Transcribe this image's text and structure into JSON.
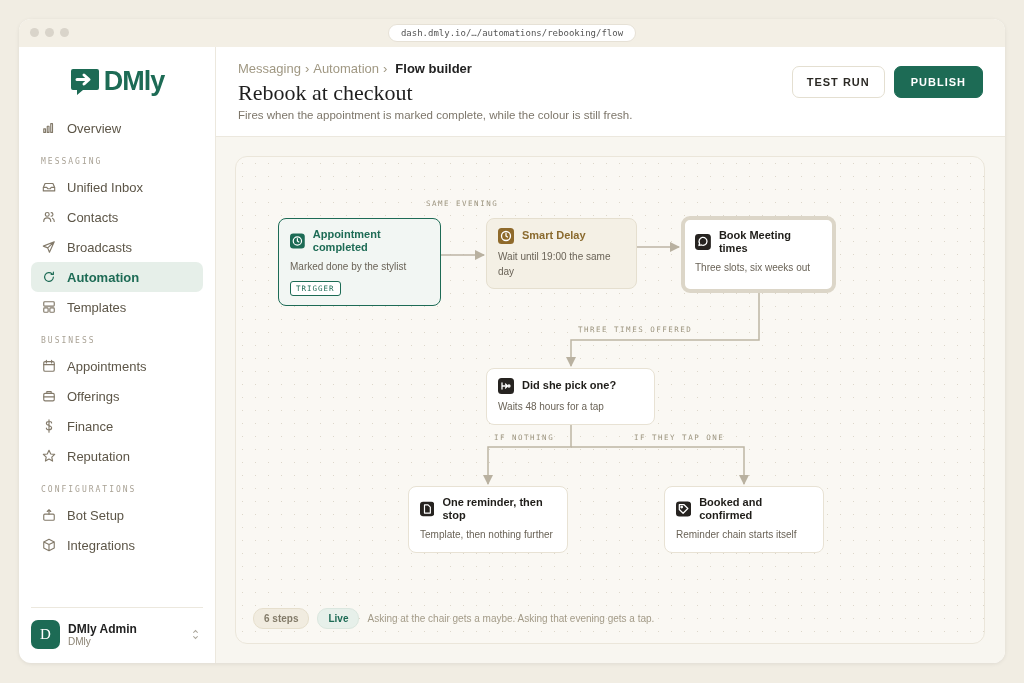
{
  "browser": {
    "url": "dash.dmly.io/…/automations/rebooking/flow"
  },
  "sidebar": {
    "logo": "DMly",
    "sections": [
      {
        "items": [
          {
            "label": "Overview",
            "selected": false
          }
        ]
      },
      {
        "heading": "MESSAGING",
        "items": [
          {
            "label": "Unified Inbox",
            "selected": false
          },
          {
            "label": "Contacts",
            "selected": false
          },
          {
            "label": "Broadcasts",
            "selected": false
          },
          {
            "label": "Automation",
            "selected": true
          },
          {
            "label": "Templates",
            "selected": false
          }
        ]
      },
      {
        "heading": "BUSINESS",
        "items": [
          {
            "label": "Appointments",
            "selected": false
          },
          {
            "label": "Offerings",
            "selected": false
          },
          {
            "label": "Finance",
            "selected": false
          },
          {
            "label": "Reputation",
            "selected": false
          }
        ]
      },
      {
        "heading": "CONFIGURATIONS",
        "items": [
          {
            "label": "Bot Setup",
            "selected": false
          },
          {
            "label": "Integrations",
            "selected": false
          }
        ]
      }
    ],
    "user": {
      "avatar": "D",
      "name": "DMly Admin",
      "org": "DMly"
    }
  },
  "header": {
    "breadcrumb": [
      "Messaging",
      "Automation",
      "Flow builder"
    ],
    "separator": "›",
    "title": "Rebook at checkout",
    "subtitle": "Fires when the appointment is marked complete, while the colour is still fresh.",
    "buttons": [
      {
        "label": "TEST RUN",
        "kind": "secondary"
      },
      {
        "label": "PUBLISH",
        "kind": "primary"
      }
    ]
  },
  "flow": {
    "nodes": [
      {
        "kind": "trigger",
        "title": "Appointment completed",
        "detail": "Marked done by the stylist",
        "tag": "TRIGGER",
        "selected": false
      },
      {
        "kind": "delay",
        "title": "Smart Delay",
        "detail": "Wait until 19:00 the same day",
        "selected": false
      },
      {
        "kind": "action",
        "title": "Book Meeting times",
        "detail": "Three slots, six weeks out",
        "selected": true
      },
      {
        "kind": "action",
        "title": "Did she pick one?",
        "detail": "Waits 48 hours for a tap",
        "selected": false
      },
      {
        "kind": "action",
        "title": "One reminder, then stop",
        "detail": "Template, then nothing further",
        "selected": false
      },
      {
        "kind": "action",
        "title": "Booked and confirmed",
        "detail": "Reminder chain starts itself",
        "selected": false
      }
    ],
    "connector_labels": [
      "SAME EVENING",
      "THREE TIMES OFFERED",
      "IF NOTHING",
      "IF THEY TAP ONE"
    ],
    "badges": [
      {
        "label": "6 steps",
        "kind": "neutral"
      },
      {
        "label": "Live",
        "kind": "live"
      }
    ],
    "note": "Asking at the chair gets a maybe. Asking that evening gets a tap."
  }
}
